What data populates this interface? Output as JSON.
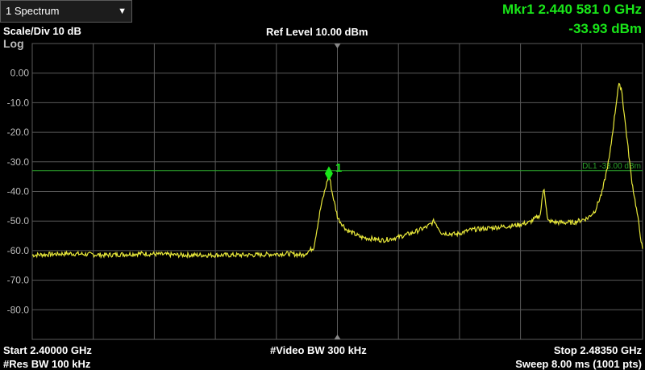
{
  "trace_selector": {
    "value": "1 Spectrum"
  },
  "header": {
    "scale_div": "Scale/Div 10 dB",
    "ref_level": "Ref Level 10.00 dBm",
    "y_scale_mode": "Log"
  },
  "marker": {
    "freq_readout": "Mkr1  2.440 581 0 GHz",
    "amp_readout": "-33.93 dBm",
    "label": "1",
    "freq_ghz": 2.440581,
    "amp_dbm": -33.93
  },
  "display_line": {
    "label": "DL1 -33.00 dBm",
    "level_dbm": -33.0
  },
  "footer": {
    "start": "Start 2.40000 GHz",
    "res_bw": "#Res BW 100 kHz",
    "video_bw": "#Video BW 300 kHz",
    "stop": "Stop 2.48350 GHz",
    "sweep": "Sweep 8.00 ms (1001 pts)"
  },
  "colors": {
    "trace": "#e8e83a",
    "marker": "#19e619",
    "grid": "#5a5a5a",
    "display_line": "#2aa02a"
  },
  "chart_data": {
    "type": "line",
    "xlabel": "",
    "ylabel": "",
    "x_range_ghz": [
      2.4,
      2.4835
    ],
    "ylim": [
      -90,
      10
    ],
    "y_ticks": [
      "0.00",
      "-10.0",
      "-20.0",
      "-30.0",
      "-40.0",
      "-50.0",
      "-60.0",
      "-70.0",
      "-80.0"
    ],
    "grid": true,
    "series": [
      {
        "name": "",
        "points": [
          [
            2.4,
            -61.5
          ],
          [
            2.405,
            -61.0
          ],
          [
            2.41,
            -61.5
          ],
          [
            2.415,
            -61.0
          ],
          [
            2.42,
            -61.5
          ],
          [
            2.425,
            -61.5
          ],
          [
            2.43,
            -61.5
          ],
          [
            2.435,
            -61.0
          ],
          [
            2.437,
            -61.5
          ],
          [
            2.4385,
            -59.0
          ],
          [
            2.4395,
            -45.0
          ],
          [
            2.4402,
            -38.0
          ],
          [
            2.4406,
            -33.9
          ],
          [
            2.441,
            -40.0
          ],
          [
            2.4418,
            -49.0
          ],
          [
            2.443,
            -53.0
          ],
          [
            2.445,
            -55.5
          ],
          [
            2.448,
            -56.5
          ],
          [
            2.45,
            -55.5
          ],
          [
            2.452,
            -54.0
          ],
          [
            2.454,
            -52.0
          ],
          [
            2.455,
            -50.0
          ],
          [
            2.456,
            -54.0
          ],
          [
            2.458,
            -54.5
          ],
          [
            2.46,
            -53.0
          ],
          [
            2.462,
            -52.5
          ],
          [
            2.464,
            -52.0
          ],
          [
            2.466,
            -51.5
          ],
          [
            2.468,
            -50.5
          ],
          [
            2.4695,
            -48.0
          ],
          [
            2.47,
            -38.0
          ],
          [
            2.4705,
            -50.0
          ],
          [
            2.472,
            -50.5
          ],
          [
            2.474,
            -50.5
          ],
          [
            2.476,
            -49.0
          ],
          [
            2.477,
            -46.5
          ],
          [
            2.478,
            -40.0
          ],
          [
            2.479,
            -28.0
          ],
          [
            2.4798,
            -12.0
          ],
          [
            2.4802,
            -4.0
          ],
          [
            2.4806,
            -5.0
          ],
          [
            2.481,
            -14.0
          ],
          [
            2.482,
            -36.0
          ],
          [
            2.4828,
            -48.0
          ],
          [
            2.4835,
            -60.0
          ]
        ]
      }
    ]
  }
}
